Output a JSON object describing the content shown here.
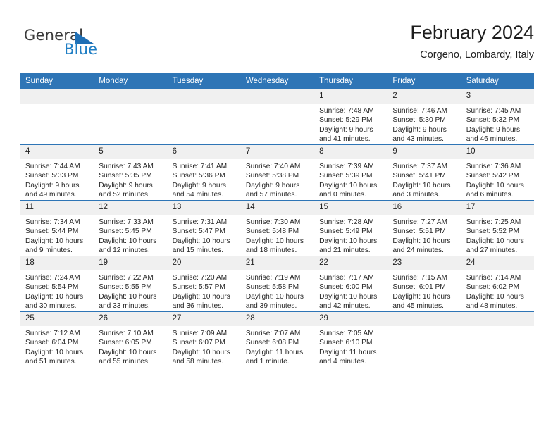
{
  "brand": {
    "name_part1": "General",
    "name_part2": "Blue",
    "accent_color": "#1f7ec4",
    "header_color": "#2e75b6"
  },
  "header": {
    "title": "February 2024",
    "location": "Corgeno, Lombardy, Italy"
  },
  "weekday_headers": [
    "Sunday",
    "Monday",
    "Tuesday",
    "Wednesday",
    "Thursday",
    "Friday",
    "Saturday"
  ],
  "weeks": [
    [
      {
        "day": "",
        "empty": true
      },
      {
        "day": "",
        "empty": true
      },
      {
        "day": "",
        "empty": true
      },
      {
        "day": "",
        "empty": true
      },
      {
        "day": "1",
        "sunrise": "Sunrise: 7:48 AM",
        "sunset": "Sunset: 5:29 PM",
        "daylight_line1": "Daylight: 9 hours",
        "daylight_line2": "and 41 minutes."
      },
      {
        "day": "2",
        "sunrise": "Sunrise: 7:46 AM",
        "sunset": "Sunset: 5:30 PM",
        "daylight_line1": "Daylight: 9 hours",
        "daylight_line2": "and 43 minutes."
      },
      {
        "day": "3",
        "sunrise": "Sunrise: 7:45 AM",
        "sunset": "Sunset: 5:32 PM",
        "daylight_line1": "Daylight: 9 hours",
        "daylight_line2": "and 46 minutes."
      }
    ],
    [
      {
        "day": "4",
        "sunrise": "Sunrise: 7:44 AM",
        "sunset": "Sunset: 5:33 PM",
        "daylight_line1": "Daylight: 9 hours",
        "daylight_line2": "and 49 minutes."
      },
      {
        "day": "5",
        "sunrise": "Sunrise: 7:43 AM",
        "sunset": "Sunset: 5:35 PM",
        "daylight_line1": "Daylight: 9 hours",
        "daylight_line2": "and 52 minutes."
      },
      {
        "day": "6",
        "sunrise": "Sunrise: 7:41 AM",
        "sunset": "Sunset: 5:36 PM",
        "daylight_line1": "Daylight: 9 hours",
        "daylight_line2": "and 54 minutes."
      },
      {
        "day": "7",
        "sunrise": "Sunrise: 7:40 AM",
        "sunset": "Sunset: 5:38 PM",
        "daylight_line1": "Daylight: 9 hours",
        "daylight_line2": "and 57 minutes."
      },
      {
        "day": "8",
        "sunrise": "Sunrise: 7:39 AM",
        "sunset": "Sunset: 5:39 PM",
        "daylight_line1": "Daylight: 10 hours",
        "daylight_line2": "and 0 minutes."
      },
      {
        "day": "9",
        "sunrise": "Sunrise: 7:37 AM",
        "sunset": "Sunset: 5:41 PM",
        "daylight_line1": "Daylight: 10 hours",
        "daylight_line2": "and 3 minutes."
      },
      {
        "day": "10",
        "sunrise": "Sunrise: 7:36 AM",
        "sunset": "Sunset: 5:42 PM",
        "daylight_line1": "Daylight: 10 hours",
        "daylight_line2": "and 6 minutes."
      }
    ],
    [
      {
        "day": "11",
        "sunrise": "Sunrise: 7:34 AM",
        "sunset": "Sunset: 5:44 PM",
        "daylight_line1": "Daylight: 10 hours",
        "daylight_line2": "and 9 minutes."
      },
      {
        "day": "12",
        "sunrise": "Sunrise: 7:33 AM",
        "sunset": "Sunset: 5:45 PM",
        "daylight_line1": "Daylight: 10 hours",
        "daylight_line2": "and 12 minutes."
      },
      {
        "day": "13",
        "sunrise": "Sunrise: 7:31 AM",
        "sunset": "Sunset: 5:47 PM",
        "daylight_line1": "Daylight: 10 hours",
        "daylight_line2": "and 15 minutes."
      },
      {
        "day": "14",
        "sunrise": "Sunrise: 7:30 AM",
        "sunset": "Sunset: 5:48 PM",
        "daylight_line1": "Daylight: 10 hours",
        "daylight_line2": "and 18 minutes."
      },
      {
        "day": "15",
        "sunrise": "Sunrise: 7:28 AM",
        "sunset": "Sunset: 5:49 PM",
        "daylight_line1": "Daylight: 10 hours",
        "daylight_line2": "and 21 minutes."
      },
      {
        "day": "16",
        "sunrise": "Sunrise: 7:27 AM",
        "sunset": "Sunset: 5:51 PM",
        "daylight_line1": "Daylight: 10 hours",
        "daylight_line2": "and 24 minutes."
      },
      {
        "day": "17",
        "sunrise": "Sunrise: 7:25 AM",
        "sunset": "Sunset: 5:52 PM",
        "daylight_line1": "Daylight: 10 hours",
        "daylight_line2": "and 27 minutes."
      }
    ],
    [
      {
        "day": "18",
        "sunrise": "Sunrise: 7:24 AM",
        "sunset": "Sunset: 5:54 PM",
        "daylight_line1": "Daylight: 10 hours",
        "daylight_line2": "and 30 minutes."
      },
      {
        "day": "19",
        "sunrise": "Sunrise: 7:22 AM",
        "sunset": "Sunset: 5:55 PM",
        "daylight_line1": "Daylight: 10 hours",
        "daylight_line2": "and 33 minutes."
      },
      {
        "day": "20",
        "sunrise": "Sunrise: 7:20 AM",
        "sunset": "Sunset: 5:57 PM",
        "daylight_line1": "Daylight: 10 hours",
        "daylight_line2": "and 36 minutes."
      },
      {
        "day": "21",
        "sunrise": "Sunrise: 7:19 AM",
        "sunset": "Sunset: 5:58 PM",
        "daylight_line1": "Daylight: 10 hours",
        "daylight_line2": "and 39 minutes."
      },
      {
        "day": "22",
        "sunrise": "Sunrise: 7:17 AM",
        "sunset": "Sunset: 6:00 PM",
        "daylight_line1": "Daylight: 10 hours",
        "daylight_line2": "and 42 minutes."
      },
      {
        "day": "23",
        "sunrise": "Sunrise: 7:15 AM",
        "sunset": "Sunset: 6:01 PM",
        "daylight_line1": "Daylight: 10 hours",
        "daylight_line2": "and 45 minutes."
      },
      {
        "day": "24",
        "sunrise": "Sunrise: 7:14 AM",
        "sunset": "Sunset: 6:02 PM",
        "daylight_line1": "Daylight: 10 hours",
        "daylight_line2": "and 48 minutes."
      }
    ],
    [
      {
        "day": "25",
        "sunrise": "Sunrise: 7:12 AM",
        "sunset": "Sunset: 6:04 PM",
        "daylight_line1": "Daylight: 10 hours",
        "daylight_line2": "and 51 minutes."
      },
      {
        "day": "26",
        "sunrise": "Sunrise: 7:10 AM",
        "sunset": "Sunset: 6:05 PM",
        "daylight_line1": "Daylight: 10 hours",
        "daylight_line2": "and 55 minutes."
      },
      {
        "day": "27",
        "sunrise": "Sunrise: 7:09 AM",
        "sunset": "Sunset: 6:07 PM",
        "daylight_line1": "Daylight: 10 hours",
        "daylight_line2": "and 58 minutes."
      },
      {
        "day": "28",
        "sunrise": "Sunrise: 7:07 AM",
        "sunset": "Sunset: 6:08 PM",
        "daylight_line1": "Daylight: 11 hours",
        "daylight_line2": "and 1 minute."
      },
      {
        "day": "29",
        "sunrise": "Sunrise: 7:05 AM",
        "sunset": "Sunset: 6:10 PM",
        "daylight_line1": "Daylight: 11 hours",
        "daylight_line2": "and 4 minutes."
      },
      {
        "day": "",
        "empty": true
      },
      {
        "day": "",
        "empty": true
      }
    ]
  ]
}
